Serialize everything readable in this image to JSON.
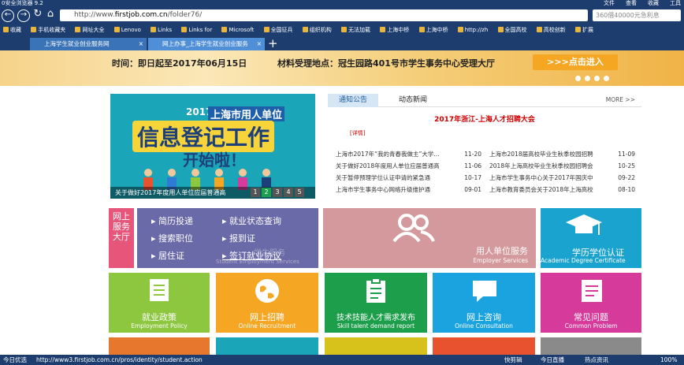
{
  "browser": {
    "title": "0安全浏览器 9.2",
    "menu": [
      "文件",
      "查看",
      "收藏",
      "工具"
    ],
    "url_prefix": "http://www.",
    "url_domain": "firstjob.com.cn",
    "url_path": "/folder76/",
    "search_placeholder": "360借40000元急利息",
    "favorites": [
      "收藏",
      "手机收藏夹",
      "网址大全",
      "Lenovo",
      "Links",
      "Links for",
      "Microsoft",
      "全国征兵",
      "组织机构",
      "无法加载",
      "上海中桥",
      "上海中桥",
      "http://zh",
      "全国高校",
      "高校创新",
      "扩展"
    ],
    "tabs": [
      {
        "label": "上海学生就业创业服务网"
      },
      {
        "label": "网上办事_上海学生就业创业服务"
      }
    ],
    "tab_add": "+",
    "status_left": "今日优选",
    "status_url": "http://www3.firstjob.com.cn/pros/identity/student.action",
    "status_right": [
      "快剪辑",
      "今日直播",
      "热点资讯"
    ],
    "zoom": "100%"
  },
  "banner": {
    "time": "时间：即日起至2017年06月15日",
    "place": "材料受理地点：冠生园路401号市学生事务中心受理大厅",
    "button": ">>>点击进入"
  },
  "slider": {
    "year": "2017",
    "line1": "上海市用人单位",
    "big": "信息登记工作",
    "big2": "开始啦！",
    "caption": "关于做好2017年度用人单位应届普通高",
    "pages": [
      "1",
      "2",
      "3",
      "4",
      "5"
    ],
    "active_page": "2"
  },
  "news": {
    "tabs": [
      "通知公告",
      "动态新闻"
    ],
    "more": "MORE >>",
    "headline": "2017年浙江-上海人才招聘大会",
    "detail": "[详情]",
    "items": [
      {
        "title": "上海市2017年“我的青春我做主”大学...",
        "date": "11-20"
      },
      {
        "title": "上海市2018届高校毕业生秋季校园招聘",
        "date": "11-09"
      },
      {
        "title": "关于做好2018年度用人单位应届普通高",
        "date": "11-06"
      },
      {
        "title": "2018年上海高校毕业生秋季校园招聘会",
        "date": "10-25"
      },
      {
        "title": "关于暂停预理学位认证申请的紧急通",
        "date": "10-17"
      },
      {
        "title": "上海市学生事务中心关于2017年国庆中",
        "date": "09-22"
      },
      {
        "title": "上海市学生事务中心网络升级维护通",
        "date": "09-01"
      },
      {
        "title": "上海市教育委员会关于2018年上海高校",
        "date": "08-10"
      }
    ]
  },
  "services": {
    "hall_label": "网上服务大厅",
    "student_links": [
      "简历投递",
      "就业状态查询",
      "搜索职位",
      "报到证",
      "居住证",
      "签订就业协议"
    ],
    "student_watermark": "学生服务",
    "student_en": "Student Employment Services",
    "employer_cn": "用人单位服务",
    "employer_en": "Employer Services",
    "degree_cn": "学历学位认证",
    "degree_en": "Academic Degree Certificate",
    "row2": [
      {
        "cn": "就业政策",
        "en": "Employment Policy",
        "color": "#8dc63f",
        "icon": "policy-icon"
      },
      {
        "cn": "网上招聘",
        "en": "Online Recruitment",
        "color": "#f5a623",
        "icon": "globe-icon"
      },
      {
        "cn": "技术技能人才需求发布",
        "en": "Skill talent demand report",
        "color": "#1d9e4a",
        "icon": "clipboard-icon"
      },
      {
        "cn": "网上咨询",
        "en": "Online Consultation",
        "color": "#1ba3e0",
        "icon": "chat-icon"
      },
      {
        "cn": "常见问题",
        "en": "Common Problem",
        "color": "#d63a9a",
        "icon": "faq-icon"
      }
    ],
    "row3_colors": [
      "#e8772e",
      "#1aa5b8",
      "#d6c21a",
      "#e8522e",
      "#8a8a8a"
    ]
  }
}
